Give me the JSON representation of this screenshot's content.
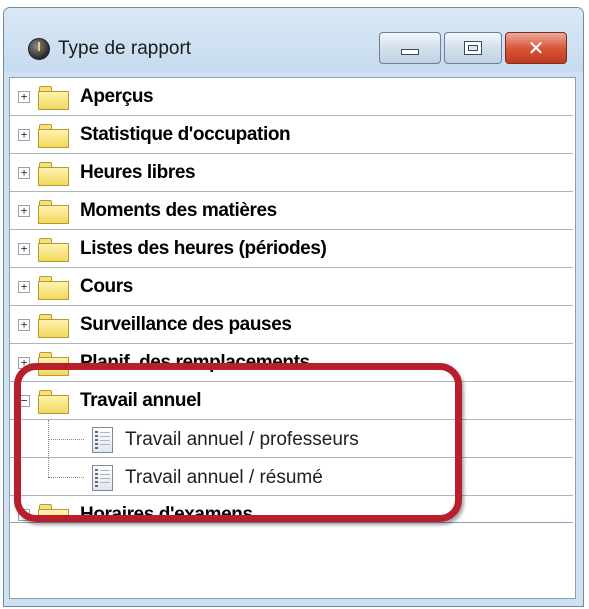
{
  "window": {
    "title": "Type de rapport",
    "icon": "clock-icon",
    "controls": {
      "minimize_icon": "minimize-icon",
      "maximize_icon": "maximize-icon",
      "close_icon": "close-icon",
      "close_glyph": "✕"
    }
  },
  "tree": {
    "expand_glyph": "+",
    "collapse_glyph": "−",
    "folders": [
      {
        "label": "Aperçus",
        "expanded": false
      },
      {
        "label": "Statistique d'occupation",
        "expanded": false
      },
      {
        "label": "Heures libres",
        "expanded": false
      },
      {
        "label": "Moments des matières",
        "expanded": false
      },
      {
        "label": "Listes des heures (périodes)",
        "expanded": false
      },
      {
        "label": "Cours",
        "expanded": false
      },
      {
        "label": "Surveillance des pauses",
        "expanded": false
      },
      {
        "label": "Planif. des remplacements",
        "expanded": false
      },
      {
        "label": "Travail annuel",
        "expanded": true
      },
      {
        "label": "Horaires d'examens",
        "expanded": false
      }
    ],
    "travail_annuel_children": [
      {
        "label": "Travail annuel / professeurs",
        "icon": "report-icon"
      },
      {
        "label": "Travail annuel / résumé",
        "icon": "report-icon"
      }
    ]
  },
  "colors": {
    "highlight": "#b81e2b",
    "window_frame": "#cfe0f1",
    "close_button": "#d6573b"
  }
}
